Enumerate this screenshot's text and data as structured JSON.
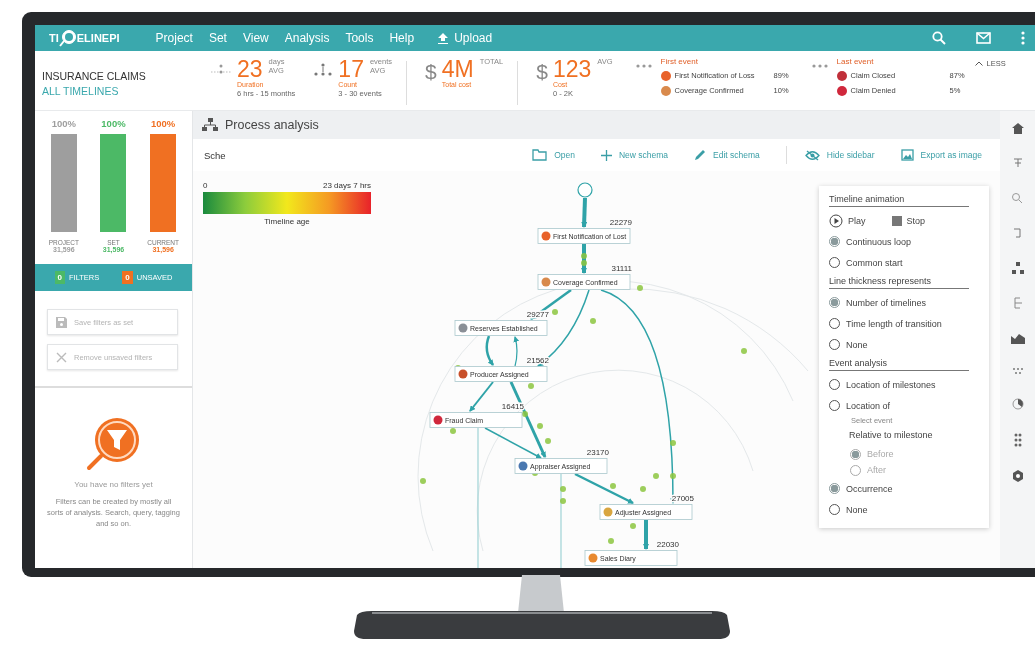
{
  "app": {
    "logo_start": "TI",
    "logo_end": "ELINEPI",
    "menu": [
      "Project",
      "Set",
      "View",
      "Analysis",
      "Tools",
      "Help"
    ],
    "upload": "Upload"
  },
  "header": {
    "title": "INSURANCE CLAIMS",
    "subtitle": "ALL TIMELINES",
    "metrics": [
      {
        "kind": "duration",
        "value": "23",
        "unit": "days",
        "unit_note": "AVG",
        "label": "Duration",
        "range": "6 hrs - 15 months"
      },
      {
        "kind": "events",
        "value": "17",
        "unit": "events",
        "unit_note": "AVG",
        "label": "Count",
        "range": "3 - 30 events"
      },
      {
        "kind": "money",
        "currency": "$",
        "value": "4M",
        "unit": "TOTAL",
        "label": "Total cost"
      },
      {
        "kind": "money",
        "currency": "$",
        "value": "123",
        "unit": "AVG",
        "label": "Cost",
        "range": "0 - 2K"
      }
    ],
    "event_groups": [
      {
        "title": "First event",
        "items": [
          {
            "label": "First Notification of Loss",
            "share": "89%",
            "color": "#e8622a"
          },
          {
            "label": "Coverage Confirmed",
            "share": "10%",
            "color": "#d98a4c"
          }
        ]
      },
      {
        "title": "Last event",
        "items": [
          {
            "label": "Claim Closed",
            "share": "87%",
            "color": "#c0303a"
          },
          {
            "label": "Claim Denied",
            "share": "5%",
            "color": "#d0283c"
          }
        ]
      }
    ],
    "less": "LESS"
  },
  "sidebar": {
    "bars": [
      {
        "percent": "100%",
        "label": "PROJECT",
        "count": "31,596",
        "level": 1,
        "color": "#9e9e9e"
      },
      {
        "percent": "100%",
        "label": "SET",
        "count": "31,596",
        "level": 1,
        "color": "#4cb966"
      },
      {
        "percent": "100%",
        "label": "CURRENT",
        "count": "31,596",
        "level": 1,
        "color": "#f07022"
      }
    ],
    "filters": [
      {
        "count": "0",
        "label": "FILTERS",
        "color": "#4cb966"
      },
      {
        "count": "0",
        "label": "UNSAVED",
        "color": "#f07022"
      }
    ],
    "actions": [
      {
        "kind": "save",
        "label": "Save filters as set",
        "disabled": true
      },
      {
        "kind": "remove",
        "label": "Remove unsaved filters",
        "disabled": true
      }
    ],
    "empty_title": "You have no filters yet",
    "empty_text": "Filters can be created by mostly all sorts of analysis. Search, query, tagging and so on."
  },
  "main": {
    "title": "Process analysis",
    "schema_label": "Sche",
    "toolbar": [
      {
        "kind": "open",
        "label": "Open"
      },
      {
        "kind": "new",
        "label": "New schema"
      },
      {
        "kind": "edit",
        "label": "Edit schema"
      },
      {
        "kind": "hide",
        "label": "Hide sidebar"
      },
      {
        "kind": "export",
        "label": "Export as image"
      }
    ],
    "legend": {
      "min": "0",
      "max": "23 days 7 hrs",
      "title": "Timeline age"
    },
    "graph": {
      "nodes": [
        {
          "label": "First Notification of Lost",
          "count": "22279",
          "color": "#e8622a"
        },
        {
          "label": "Coverage Confirmed",
          "count": "31111",
          "color": "#d98a4c"
        },
        {
          "label": "Reserves Established",
          "count": "29277",
          "color": "#8a8f96"
        },
        {
          "label": "Producer Assigned",
          "count": "21562",
          "color": "#c8502a"
        },
        {
          "label": "Fraud Claim",
          "count": "16415",
          "color": "#d0283c"
        },
        {
          "label": "Appraiser Assigned",
          "count": "23170",
          "color": "#4a78b0"
        },
        {
          "label": "Adjuster Assigned",
          "count": "27005",
          "color": "#d9a640"
        },
        {
          "label": "Sales Diary",
          "count": "22030",
          "color": "#e88a30"
        }
      ]
    },
    "options": [
      {
        "title": "Timeline animation",
        "items": [
          {
            "kind": "playback",
            "play": "Play",
            "stop": "Stop"
          },
          {
            "kind": "radio",
            "label": "Continuous loop",
            "selected": true
          },
          {
            "kind": "radio",
            "label": "Common start",
            "selected": false
          }
        ]
      },
      {
        "title": "Line thickness represents",
        "items": [
          {
            "kind": "radio",
            "label": "Number of timelines",
            "selected": true
          },
          {
            "kind": "radio",
            "label": "Time length of transition",
            "selected": false
          },
          {
            "kind": "radio",
            "label": "None",
            "selected": false
          }
        ]
      },
      {
        "title": "Event analysis",
        "items": [
          {
            "kind": "radio",
            "label": "Location of milestones",
            "selected": false
          },
          {
            "kind": "radio",
            "label": "Location of",
            "selected": false
          },
          {
            "kind": "hint",
            "label": "Select event"
          },
          {
            "kind": "subheading",
            "label": "Relative to milestone"
          },
          {
            "kind": "subradio",
            "label": "Before",
            "selected": true,
            "disabled": true
          },
          {
            "kind": "subradio",
            "label": "After",
            "selected": false,
            "disabled": true
          },
          {
            "kind": "radio",
            "label": "Occurrence",
            "selected": true
          },
          {
            "kind": "radio",
            "label": "None",
            "selected": false
          }
        ]
      }
    ]
  }
}
